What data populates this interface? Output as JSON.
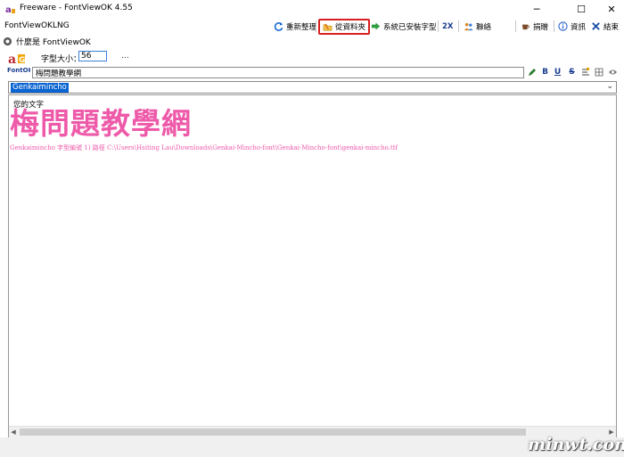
{
  "window": {
    "title": "Freeware - FontViewOK 4.55",
    "minimize_glyph": "─",
    "maximize_glyph": "☐",
    "close_glyph": "✕"
  },
  "menu": {
    "items": [
      "FontViewOK",
      "LNG"
    ]
  },
  "toolbar": {
    "reload_label": "重新整理",
    "from_folder_label": "從資料夾",
    "installed_label": "系統已安裝字型",
    "twox_label": "2X",
    "contact_label": "聯絡",
    "donate_label": "捐贈",
    "info_label": "資訊",
    "exit_label": "結束"
  },
  "whatis": {
    "label": "什麼是 FontViewOK"
  },
  "logo": {
    "text": "FontOK"
  },
  "font_size": {
    "label": "字型大小：",
    "value": "56",
    "more": "..."
  },
  "sample": {
    "value": "梅問題教學網"
  },
  "format_buttons": [
    "B",
    "U",
    "S"
  ],
  "font_select": {
    "value": "Genkaimincho"
  },
  "preview": {
    "label": "您的文字",
    "big_text": "梅問題教學網",
    "path_text": "Genkaimincho 字型編號  1) 路徑  C:\\Users\\Hsiting Lau\\Downloads\\Genkai-Mincho-font\\Genkai-Mincho-font\\genkai-mincho.ttf"
  },
  "watermark": {
    "text": "minwt.com"
  },
  "colors": {
    "accent": "#0a64d2",
    "preview_pink": "#ee5aa9",
    "highlight_red": "#d81e1e"
  }
}
